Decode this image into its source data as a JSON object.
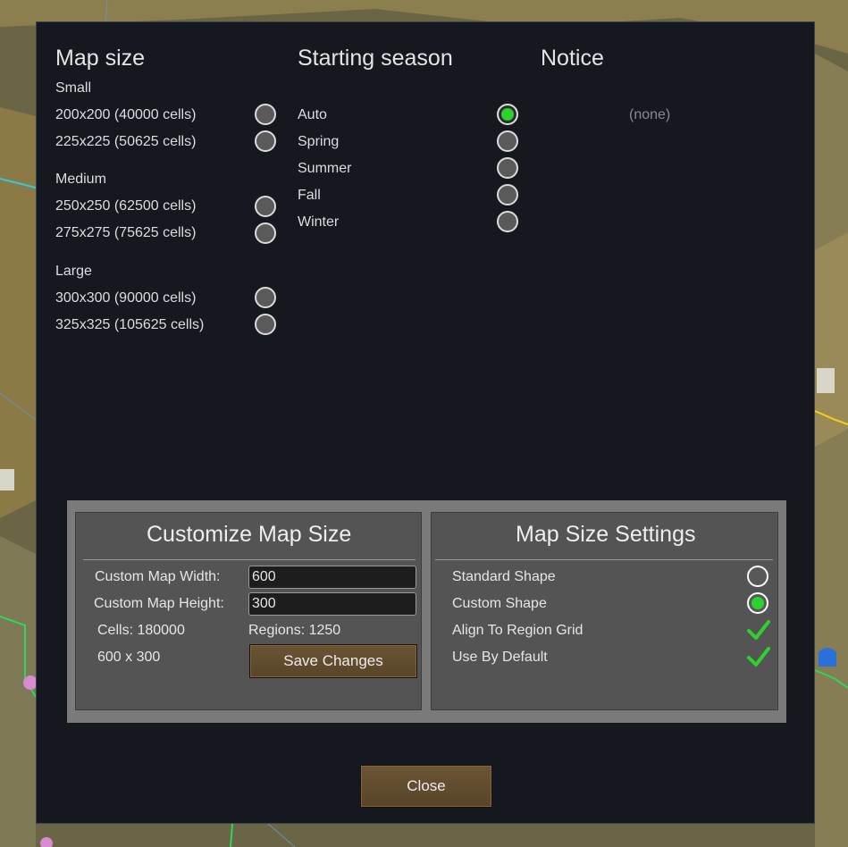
{
  "map_size": {
    "title": "Map size",
    "groups": [
      {
        "label": "Small",
        "options": [
          {
            "label": "200x200 (40000 cells)",
            "selected": false
          },
          {
            "label": "225x225 (50625 cells)",
            "selected": false
          }
        ]
      },
      {
        "label": "Medium",
        "options": [
          {
            "label": "250x250 (62500 cells)",
            "selected": false
          },
          {
            "label": "275x275 (75625 cells)",
            "selected": false
          }
        ]
      },
      {
        "label": "Large",
        "options": [
          {
            "label": "300x300 (90000 cells)",
            "selected": false
          },
          {
            "label": "325x325 (105625 cells)",
            "selected": false
          }
        ]
      }
    ]
  },
  "starting_season": {
    "title": "Starting season",
    "options": [
      {
        "label": "Auto",
        "selected": true
      },
      {
        "label": "Spring",
        "selected": false
      },
      {
        "label": "Summer",
        "selected": false
      },
      {
        "label": "Fall",
        "selected": false
      },
      {
        "label": "Winter",
        "selected": false
      }
    ]
  },
  "notice": {
    "title": "Notice",
    "value": "(none)"
  },
  "customize": {
    "title": "Customize Map Size",
    "width_label": "Custom Map Width:",
    "width_value": "600",
    "height_label": "Custom Map Height:",
    "height_value": "300",
    "cells_text": "Cells: 180000",
    "regions_text": "Regions: 1250",
    "dims_text": "600 x 300",
    "save_label": "Save Changes"
  },
  "settings": {
    "title": "Map Size Settings",
    "standard_shape": {
      "label": "Standard Shape",
      "selected": false
    },
    "custom_shape": {
      "label": "Custom Shape",
      "selected": true
    },
    "align_region_grid": {
      "label": "Align To Region Grid",
      "checked": true
    },
    "use_by_default": {
      "label": "Use By Default",
      "checked": true
    }
  },
  "close_label": "Close",
  "colors": {
    "window_bg": "#15191f",
    "radio_selected": "#2ed12e",
    "check_green": "#2ed12e",
    "button_brown": "#5f4a2f"
  }
}
